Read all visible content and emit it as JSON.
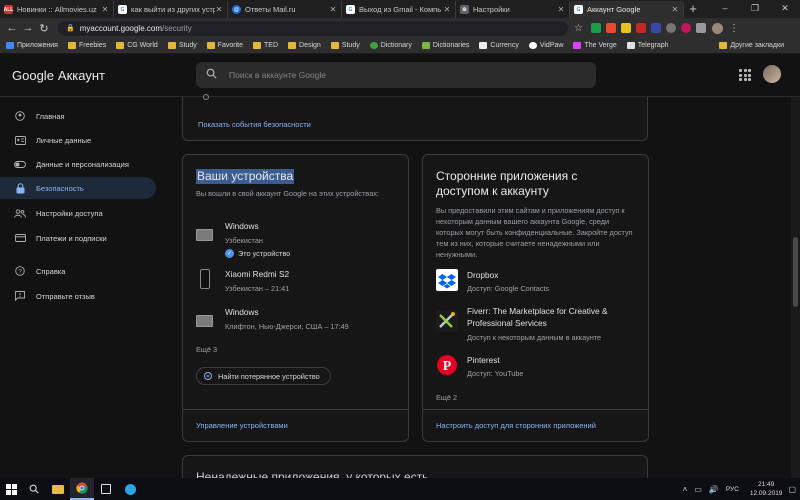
{
  "browser": {
    "tabs": [
      {
        "title": "Новинки :: Allmovies.uz",
        "favicon_text": "ALL",
        "favicon_color": "#d32f2f",
        "active": false
      },
      {
        "title": "как выйти из других устр",
        "favicon_text": "G",
        "favicon_color": "#ffffff",
        "active": false
      },
      {
        "title": "Ответы Mail.ru",
        "favicon_text": "@",
        "favicon_color": "#1e6fd9",
        "active": false
      },
      {
        "title": "Выход из Gmail - Компь",
        "favicon_text": "G",
        "favicon_color": "#ffffff",
        "active": false
      },
      {
        "title": "Настройки",
        "favicon_text": "⚙",
        "favicon_color": "#5f6368",
        "active": false
      },
      {
        "title": "Аккаунт Google",
        "favicon_text": "G",
        "favicon_color": "#ffffff",
        "active": true
      }
    ],
    "url_host": "myaccount.google.com",
    "url_path": "/security",
    "bookmarks": [
      {
        "label": "Приложения",
        "kind": "apps"
      },
      {
        "label": "Freebies",
        "kind": "folder"
      },
      {
        "label": "CG World",
        "kind": "folder"
      },
      {
        "label": "Study",
        "kind": "folder"
      },
      {
        "label": "Favorite",
        "kind": "folder"
      },
      {
        "label": "TED",
        "kind": "folder"
      },
      {
        "label": "Design",
        "kind": "folder"
      },
      {
        "label": "Study",
        "kind": "folder"
      },
      {
        "label": "Dictionary",
        "kind": "site"
      },
      {
        "label": "Dictionaries",
        "kind": "site"
      },
      {
        "label": "Currency",
        "kind": "site"
      },
      {
        "label": "VidPaw",
        "kind": "site"
      },
      {
        "label": "The Verge",
        "kind": "site"
      },
      {
        "label": "Telegraph",
        "kind": "site"
      }
    ],
    "other_bookmarks": "Другие закладки"
  },
  "header": {
    "logo_google": "Google",
    "logo_product": "Аккаунт",
    "search_placeholder": "Поиск в аккаунте Google"
  },
  "sidebar": {
    "items": [
      {
        "label": "Главная",
        "icon": "account-circle-icon",
        "active": false
      },
      {
        "label": "Личные данные",
        "icon": "id-card-icon",
        "active": false
      },
      {
        "label": "Данные и персонализация",
        "icon": "toggle-icon",
        "active": false
      },
      {
        "label": "Безопасность",
        "icon": "lock-icon",
        "active": true
      },
      {
        "label": "Настройки доступа",
        "icon": "people-icon",
        "active": false
      },
      {
        "label": "Платежи и подписки",
        "icon": "credit-card-icon",
        "active": false
      },
      {
        "label": "Справка",
        "icon": "help-icon",
        "active": false
      },
      {
        "label": "Отправьте отзыв",
        "icon": "feedback-icon",
        "active": false
      }
    ]
  },
  "main": {
    "security_events_link": "Показать события безопасности",
    "devices": {
      "title": "Ваши устройства",
      "description": "Вы вошли в свой аккаунт Google на этих устройствах:",
      "items": [
        {
          "name": "Windows",
          "detail": "Узбекистан",
          "this_device": "Это устройство",
          "type": "laptop"
        },
        {
          "name": "Xiaomi Redmi S2",
          "detail": "Узбекистан – 21:41",
          "type": "phone"
        },
        {
          "name": "Windows",
          "detail": "Клифтон, Нью-Джерси, США – 17:49",
          "type": "laptop"
        }
      ],
      "more": "Ещё 3",
      "find_button": "Найти потерянное устройство",
      "manage_link": "Управление устройствами"
    },
    "apps": {
      "title": "Сторонние приложения с доступом к аккаунту",
      "description": "Вы предоставили этим сайтам и приложениям доступ к некоторым данным вашего аккаунта Google, среди которых могут быть конфиденциальные. Закройте доступ тем из них, которые считаете ненадежными или ненужными.",
      "items": [
        {
          "name": "Dropbox",
          "access": "Доступ: Google Contacts",
          "icon": "dropbox-icon"
        },
        {
          "name": "Fiverr: The Marketplace for Creative & Professional Services",
          "access": "Доступ к некоторым данным в аккаунте",
          "icon": "fiverr-icon"
        },
        {
          "name": "Pinterest",
          "access": "Доступ: YouTube",
          "icon": "pinterest-icon"
        }
      ],
      "more": "Ещё 2",
      "manage_link": "Настроить доступ для сторонних приложений"
    },
    "next_section_title": "Ненадежные приложения, у которых есть"
  },
  "taskbar": {
    "language": "РУС",
    "time": "21:49",
    "date": "12.09.2019"
  },
  "colors": {
    "accent": "#8ab4f8",
    "background": "#121212",
    "selection": "#3a5c91"
  }
}
